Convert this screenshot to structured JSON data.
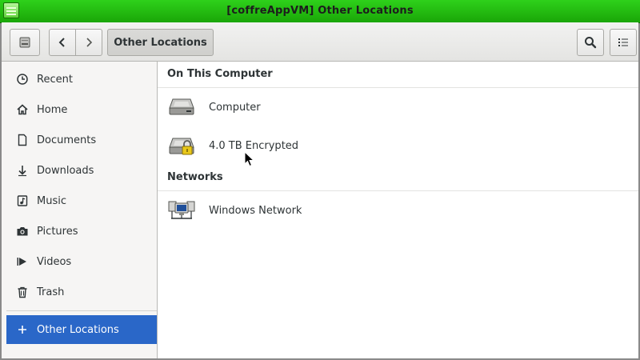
{
  "window": {
    "title": "[coffreAppVM] Other Locations"
  },
  "headerbar": {
    "path_label": "Other Locations"
  },
  "sidebar": {
    "items": [
      {
        "label": "Recent",
        "icon": "clock-icon"
      },
      {
        "label": "Home",
        "icon": "home-icon"
      },
      {
        "label": "Documents",
        "icon": "document-icon"
      },
      {
        "label": "Downloads",
        "icon": "download-icon"
      },
      {
        "label": "Music",
        "icon": "music-icon"
      },
      {
        "label": "Pictures",
        "icon": "camera-icon"
      },
      {
        "label": "Videos",
        "icon": "video-icon"
      },
      {
        "label": "Trash",
        "icon": "trash-icon"
      }
    ],
    "other_locations": {
      "label": "Other Locations",
      "icon": "plus-icon"
    }
  },
  "main": {
    "on_this_computer": {
      "header": "On This Computer",
      "items": [
        {
          "label": "Computer",
          "icon": "drive-icon"
        },
        {
          "label": "4.0 TB Encrypted",
          "icon": "encrypted-drive-icon"
        }
      ]
    },
    "networks": {
      "header": "Networks",
      "items": [
        {
          "label": "Windows Network",
          "icon": "network-icon"
        }
      ]
    }
  },
  "colors": {
    "titlebar": "#1fb40d",
    "selection": "#2a67c8"
  }
}
